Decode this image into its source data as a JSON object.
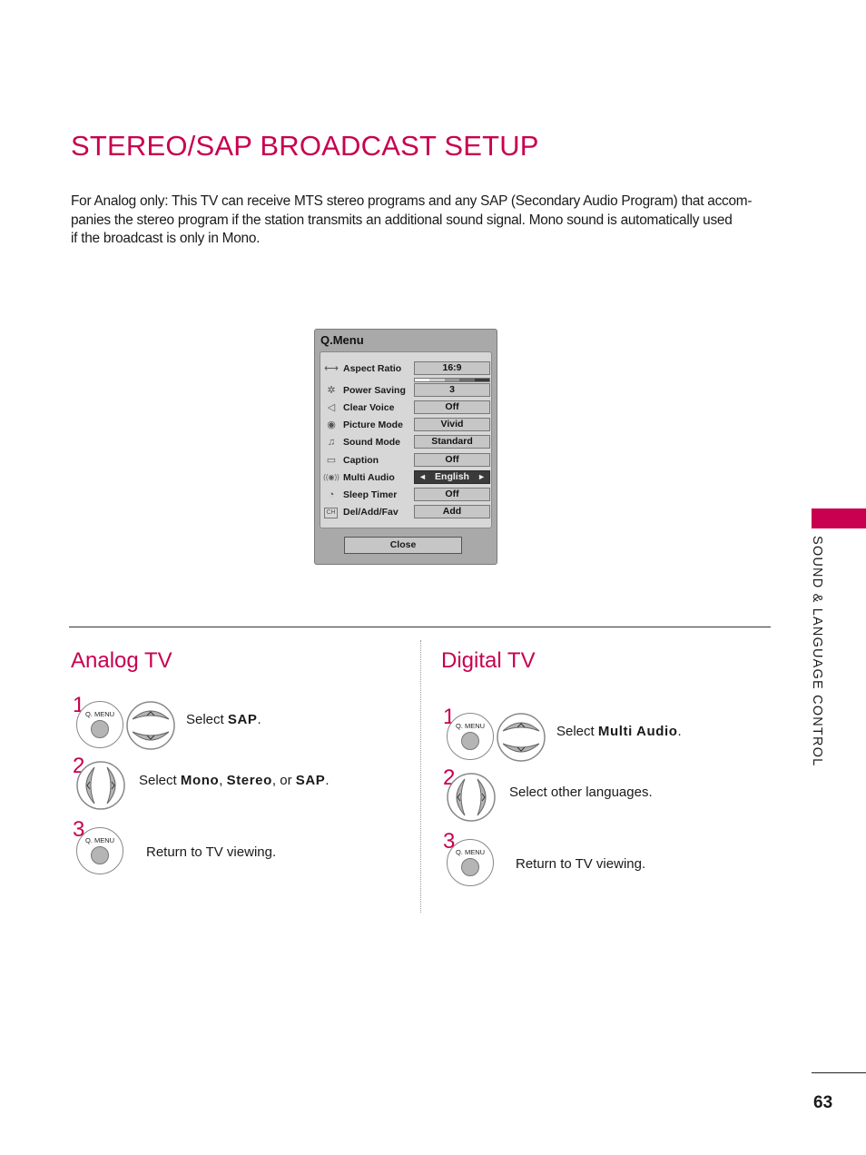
{
  "page": {
    "title": "STEREO/SAP BROADCAST SETUP",
    "intro_lines": [
      "For Analog only: This TV can receive MTS stereo programs and any SAP (Secondary Audio Program) that accom-",
      "panies the stereo program if the station transmits an additional sound signal. Mono sound is automatically used",
      "if the broadcast is only in Mono."
    ],
    "side_tab_label": "SOUND & LANGUAGE CONTROL",
    "page_number": "63",
    "accent_color": "#c8004f"
  },
  "qmenu": {
    "title": "Q.Menu",
    "items": [
      {
        "icon": "aspect-ratio-icon",
        "glyph": "⟷",
        "label": "Aspect Ratio",
        "value": "16:9"
      },
      {
        "icon": "power-saving-icon",
        "glyph": "✲",
        "label": "Power Saving",
        "value": "3"
      },
      {
        "icon": "clear-voice-icon",
        "glyph": "◁",
        "label": "Clear Voice",
        "value": "Off"
      },
      {
        "icon": "picture-mode-icon",
        "glyph": "◉",
        "label": "Picture Mode",
        "value": "Vivid"
      },
      {
        "icon": "sound-mode-icon",
        "glyph": "♫",
        "label": "Sound Mode",
        "value": "Standard"
      },
      {
        "icon": "caption-icon",
        "glyph": "▭",
        "label": "Caption",
        "value": "Off"
      },
      {
        "icon": "multi-audio-icon",
        "glyph": "((◉))",
        "label": "Multi Audio",
        "value": "English"
      },
      {
        "icon": "sleep-timer-icon",
        "glyph": "◔",
        "label": "Sleep Timer",
        "value": "Off"
      },
      {
        "icon": "channel-icon",
        "glyph": "CH",
        "label": "Del/Add/Fav",
        "value": "Add"
      }
    ],
    "power_saving_level": "3 of 5",
    "selected_item": "Multi Audio",
    "arrow_left": "◄",
    "arrow_right": "►",
    "close_label": "Close"
  },
  "analog": {
    "heading": "Analog TV",
    "steps": [
      {
        "num": "1",
        "pre": "Select ",
        "bold": "SAP",
        "post": "."
      },
      {
        "num": "2",
        "pre": "Select ",
        "bold": "Mono",
        "mid1": ", ",
        "bold2": "Stereo",
        "mid2": ", or ",
        "bold3": "SAP",
        "post": "."
      },
      {
        "num": "3",
        "text": "Return to TV viewing."
      }
    ]
  },
  "digital": {
    "heading": "Digital TV",
    "steps": [
      {
        "num": "1",
        "pre": "Select ",
        "bold": "Multi Audio",
        "post": "."
      },
      {
        "num": "2",
        "text": "Select other languages."
      },
      {
        "num": "3",
        "text": "Return to TV viewing."
      }
    ]
  },
  "remote": {
    "qmenu_label": "Q. MENU",
    "up_glyph": "^",
    "down_glyph": "v",
    "left_glyph": "<",
    "right_glyph": ">"
  }
}
